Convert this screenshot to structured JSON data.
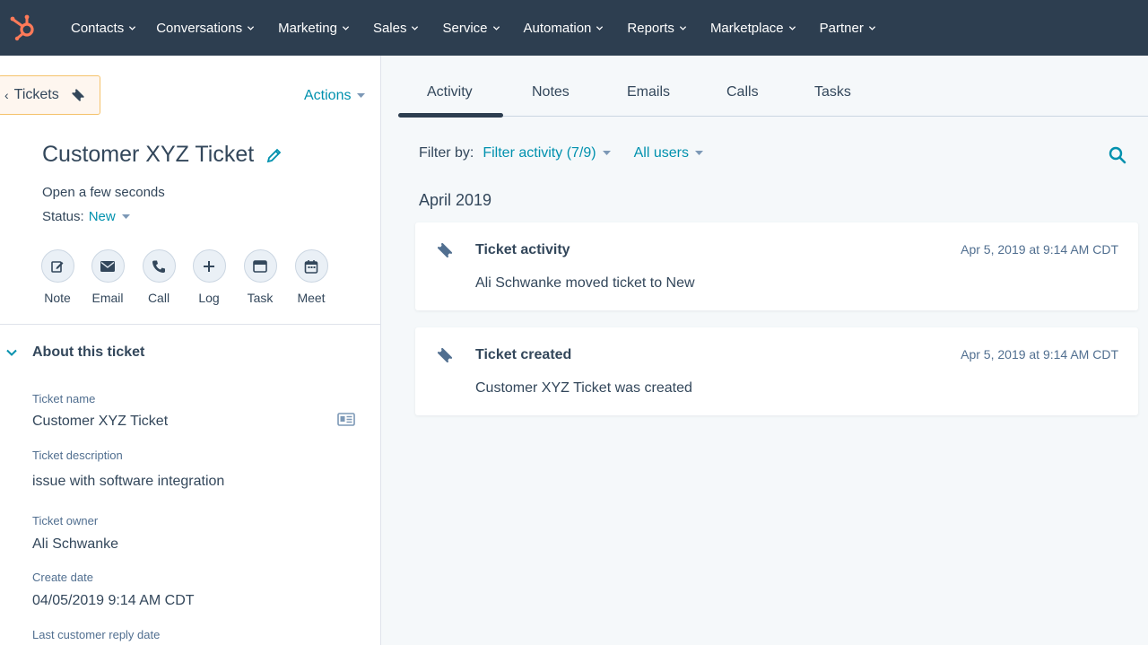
{
  "nav": {
    "logo": "hubspot-sprocket-logo",
    "items": [
      {
        "label": "Contacts"
      },
      {
        "label": "Conversations"
      },
      {
        "label": "Marketing"
      },
      {
        "label": "Sales"
      },
      {
        "label": "Service"
      },
      {
        "label": "Automation"
      },
      {
        "label": "Reports"
      },
      {
        "label": "Marketplace"
      },
      {
        "label": "Partner"
      }
    ]
  },
  "left": {
    "back_label": "Tickets",
    "actions_label": "Actions",
    "title": "Customer XYZ Ticket",
    "open_time": "Open a few seconds",
    "status_label": "Status:",
    "status_value": "New",
    "quick_actions": [
      {
        "label": "Note",
        "icon": "edit-icon"
      },
      {
        "label": "Email",
        "icon": "envelope-icon"
      },
      {
        "label": "Call",
        "icon": "phone-icon"
      },
      {
        "label": "Log",
        "icon": "plus-icon"
      },
      {
        "label": "Task",
        "icon": "task-icon"
      },
      {
        "label": "Meet",
        "icon": "calendar-icon"
      }
    ],
    "about_title": "About this ticket",
    "properties": [
      {
        "label": "Ticket name",
        "value": "Customer XYZ Ticket"
      },
      {
        "label": "Ticket description",
        "value": "issue with software integration"
      },
      {
        "label": "Ticket owner",
        "value": "Ali Schwanke"
      },
      {
        "label": "Create date",
        "value": "04/05/2019 9:14 AM CDT"
      },
      {
        "label": "Last customer reply date",
        "value": ""
      }
    ]
  },
  "right": {
    "tabs": [
      {
        "label": "Activity",
        "active": true
      },
      {
        "label": "Notes"
      },
      {
        "label": "Emails"
      },
      {
        "label": "Calls"
      },
      {
        "label": "Tasks"
      }
    ],
    "filter_label": "Filter by:",
    "filter_activity": "Filter activity (7/9)",
    "filter_users": "All users",
    "month": "April 2019",
    "activities": [
      {
        "title": "Ticket activity",
        "date": "Apr 5, 2019 at 9:14 AM CDT",
        "body": "Ali Schwanke moved ticket to New"
      },
      {
        "title": "Ticket created",
        "date": "Apr 5, 2019 at 9:14 AM CDT",
        "body": "Customer XYZ Ticket was created"
      }
    ]
  },
  "colors": {
    "nav_bg": "#2d3e50",
    "accent_teal": "#0091ae",
    "logo_orange": "#ff7a59",
    "text": "#33475b"
  }
}
